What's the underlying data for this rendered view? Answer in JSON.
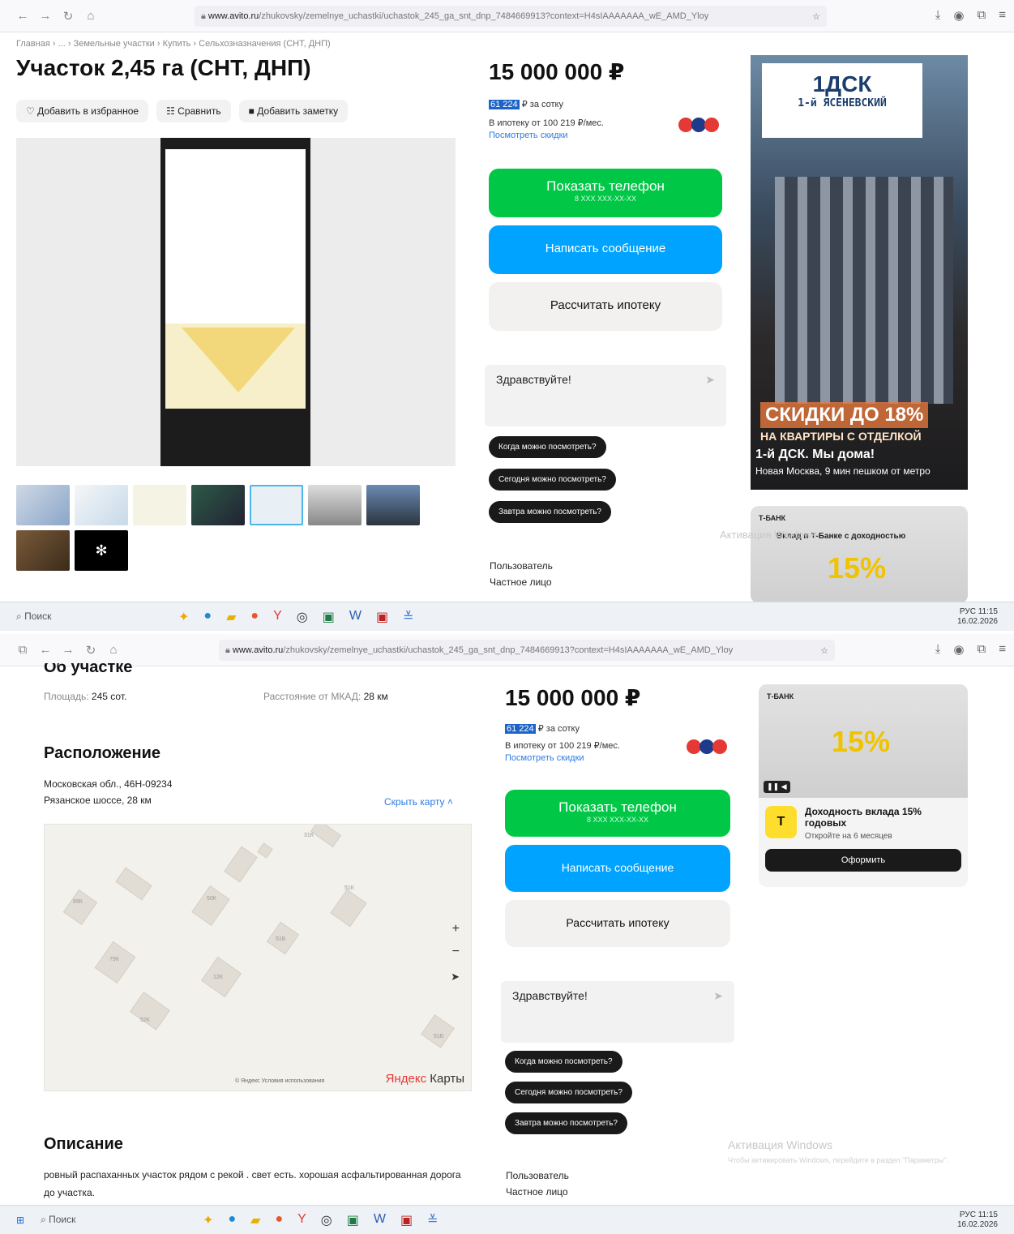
{
  "browser": {
    "url_host": "www.avito.ru",
    "url_path": "/zhukovsky/zemelnye_uchastki/uchastok_245_ga_snt_dnp_7484669913?context=H4sIAAAAAAA_wE_AMD_Yloy"
  },
  "breadcrumb": "Главная › ... › Земельные участки › Купить › Сельхозназначения (СНТ, ДНП)",
  "title": "Участок 2,45 га (СНТ, ДНП)",
  "actions": {
    "favorite": "♡ Добавить в избранное",
    "compare": "Сравнить",
    "note": "Добавить заметку"
  },
  "price": {
    "value": "15 000 000 ₽",
    "per_sotka_num": "61 224",
    "per_sotka_suffix": "₽ за сотку",
    "mortgage": "В ипотеку от 100 219 ₽/мес.",
    "discount_link": "Посмотреть скидки"
  },
  "buttons": {
    "show_phone": "Показать телефон",
    "phone_mask": "8 XXX XXX-XX-XX",
    "write_message": "Написать сообщение",
    "calc_mortgage": "Рассчитать ипотеку"
  },
  "chat": {
    "greeting": "Здравствуйте!",
    "quick": [
      "Когда можно посмотреть?",
      "Сегодня можно посмотреть?",
      "Завтра можно посмотреть?"
    ]
  },
  "seller": {
    "label": "Пользователь",
    "type": "Частное лицо"
  },
  "ad_dsk": {
    "brand": "1ДСК",
    "project": "1-й ЯСЕНЕВСКИЙ",
    "discount": "СКИДКИ ДО 18%",
    "line1": "НА КВАРТИРЫ С ОТДЕЛКОЙ",
    "line2": "1-й ДСК. Мы дома!",
    "line3": "Новая Москва, 9 мин пешком от метро"
  },
  "ad_tbank": {
    "bank": "Т-БАНК",
    "headline_short": "Вклад в Т-Банке с доходностью",
    "big": "15%",
    "title": "Доходность вклада 15% годовых",
    "sub": "Откройте на 6 месяцев",
    "cta": "Оформить"
  },
  "about": {
    "heading": "Об участке",
    "area_label": "Площадь:",
    "area_value": "245 сот.",
    "mkad_label": "Расстояние от МКАД:",
    "mkad_value": "28 км"
  },
  "location": {
    "heading": "Расположение",
    "address1": "Московская обл., 46Н-09234",
    "address2": "Рязанское шоссе, 28 км",
    "hide_map": "Скрыть карту ˄",
    "map_brand_a": "Яндекс",
    "map_brand_b": " Карты",
    "copyright": "© Яндекс Условия использования",
    "house_numbers": [
      "31К",
      "50К",
      "51К",
      "89К",
      "51Б",
      "79К",
      "12К",
      "52К",
      "51Б"
    ]
  },
  "description": {
    "heading": "Описание",
    "text": "ровный распаханных участок рядом с рекой . свет есть. хорошая асфальтированная дорога до участка."
  },
  "taskbar": {
    "search": "Поиск",
    "lang": "РУС",
    "time": "11:15",
    "date": "16.02.2026"
  },
  "watermark": {
    "line1": "Активация Windows",
    "line2": "Чтобы активировать Windows, перейдите в раздел \"Параметры\"."
  }
}
